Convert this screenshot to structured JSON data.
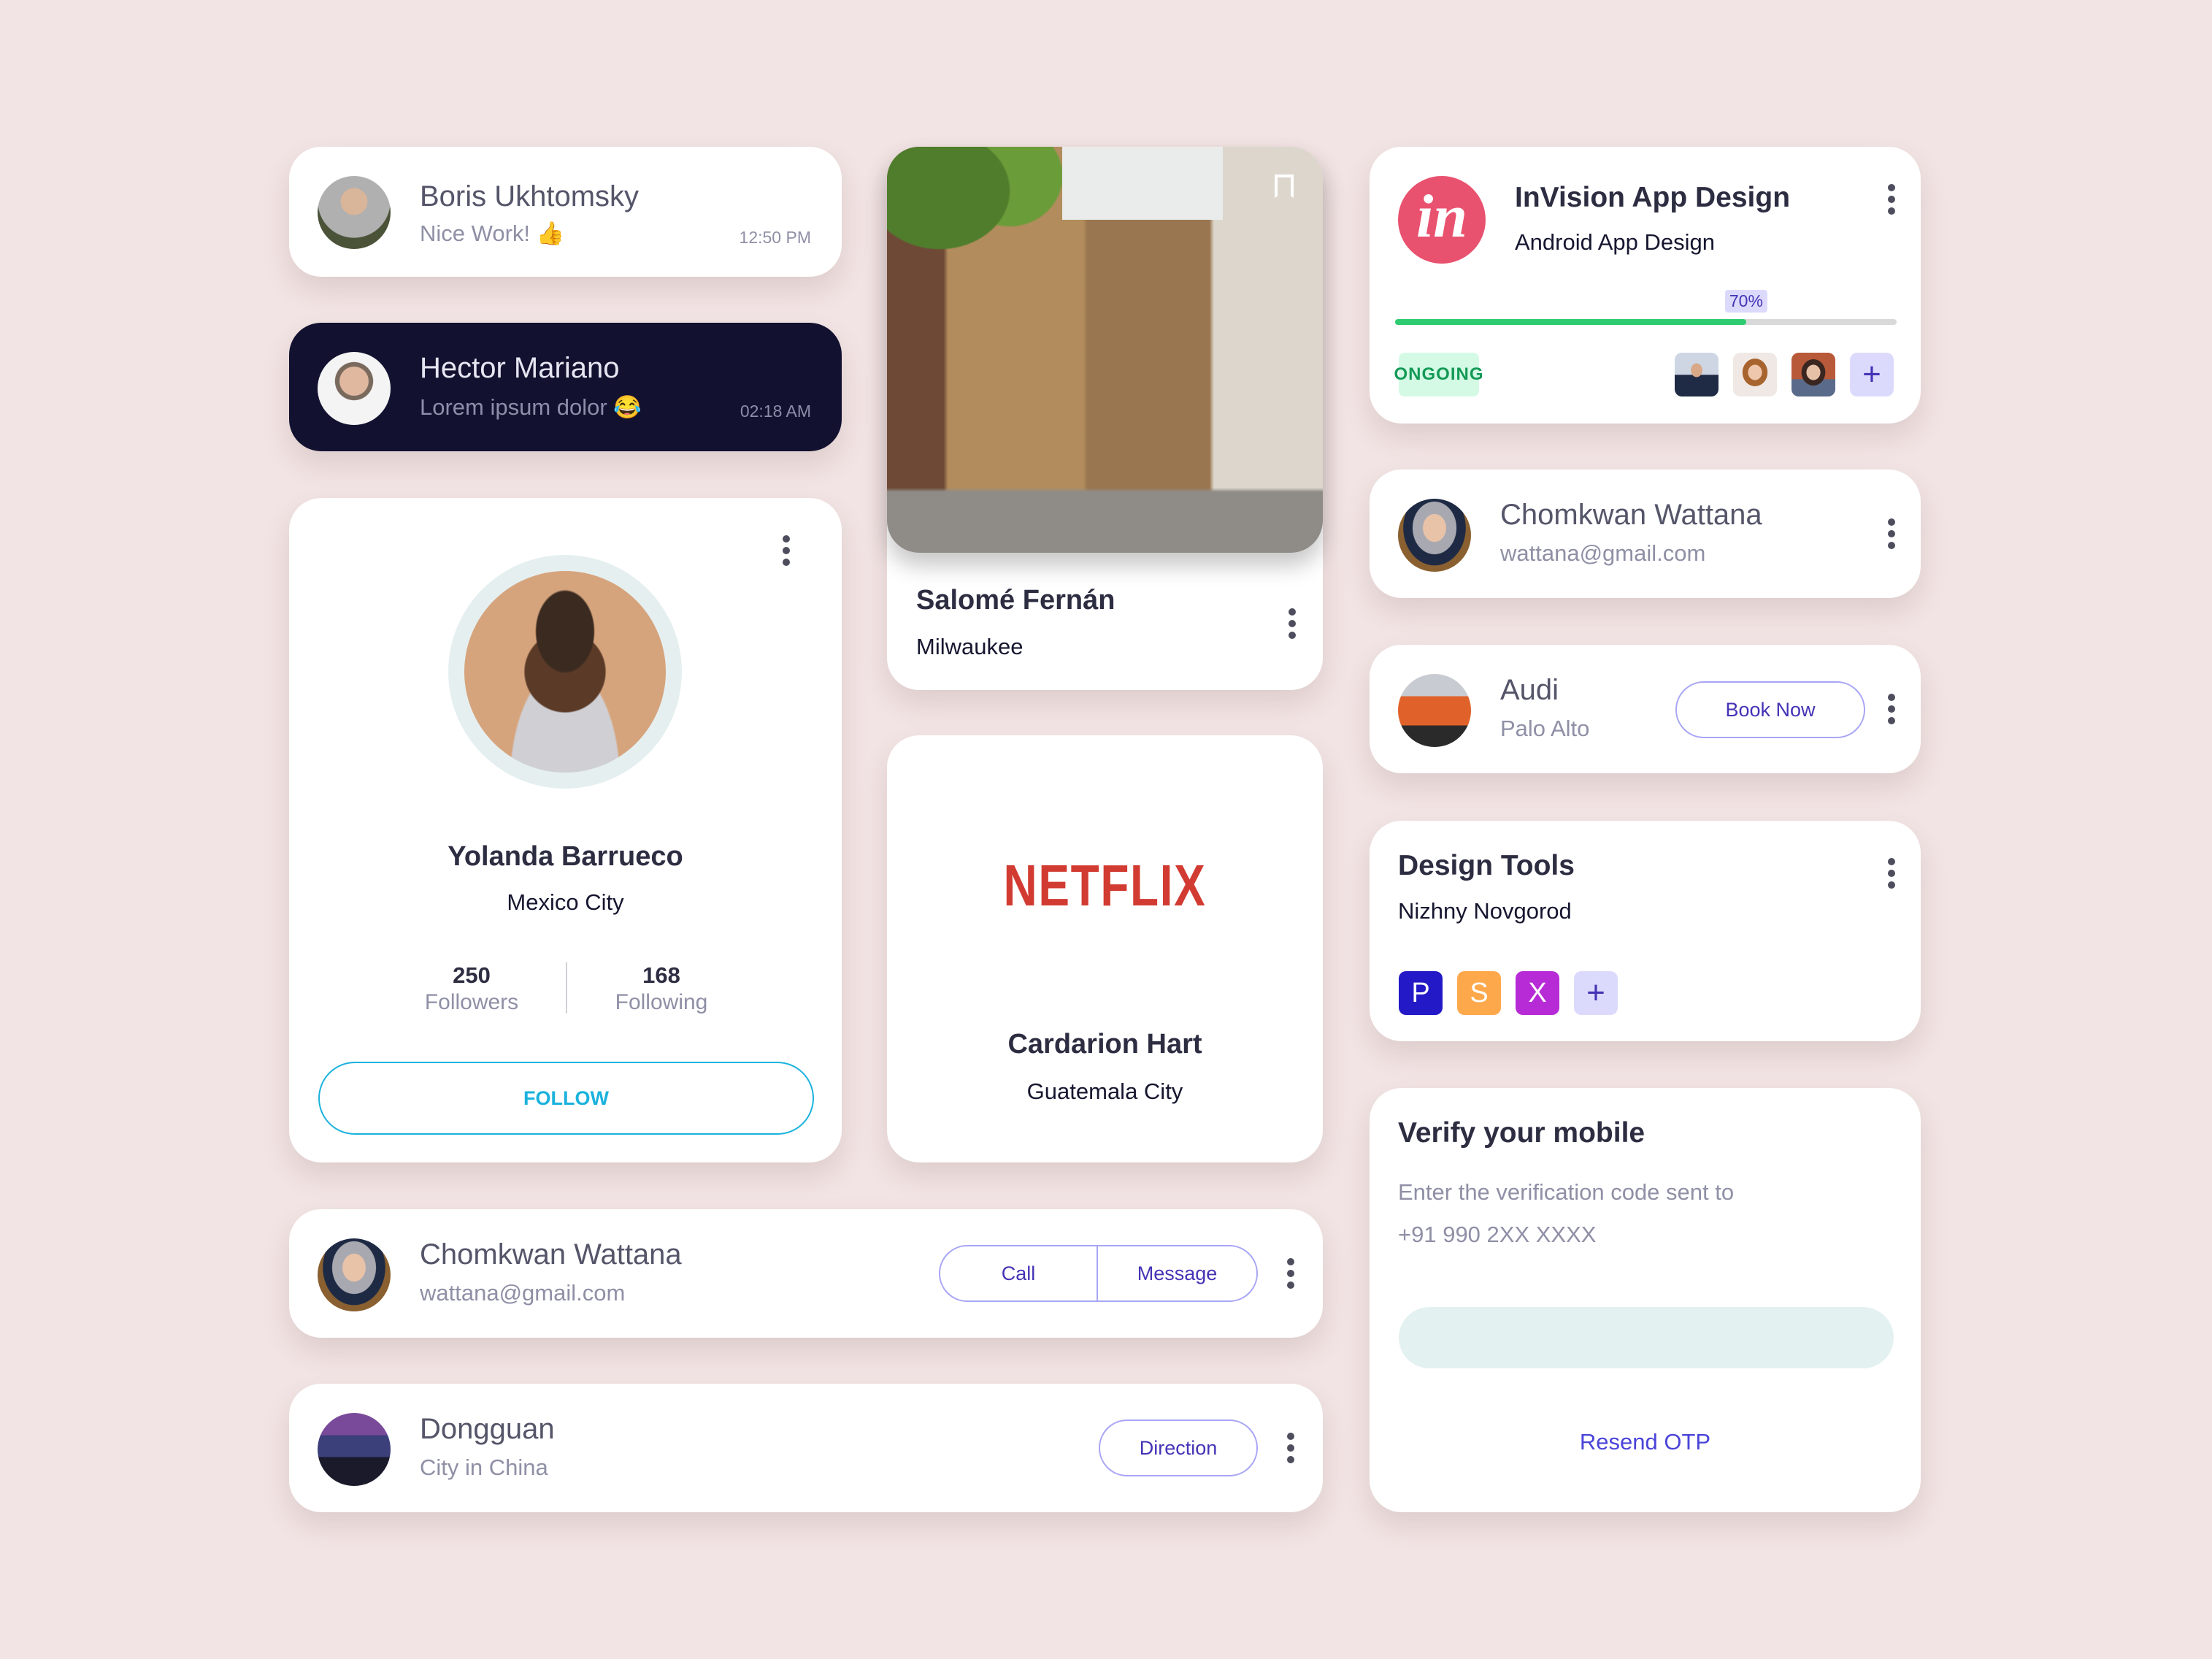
{
  "chats": [
    {
      "name": "Boris Ukhtomsky",
      "message": "Nice Work! 👍",
      "time": "12:50 PM",
      "theme": "light"
    },
    {
      "name": "Hector Mariano",
      "message": "Lorem ipsum dolor 😂",
      "time": "02:18 AM",
      "theme": "dark"
    }
  ],
  "profile": {
    "name": "Yolanda Barrueco",
    "location": "Mexico City",
    "followers_count": "250",
    "followers_label": "Followers",
    "following_count": "168",
    "following_label": "Following",
    "follow_button": "FOLLOW"
  },
  "photo_card": {
    "name": "Salomé Fernán",
    "location": "Milwaukee"
  },
  "netflix_card": {
    "logo_text": "NETFLIX",
    "name": "Cardarion Hart",
    "location": "Guatemala City"
  },
  "contact_bottom": {
    "name": "Chomkwan Wattana",
    "email": "wattana@gmail.com",
    "call_label": "Call",
    "message_label": "Message"
  },
  "place": {
    "name": "Dongguan",
    "subtitle": "City in China",
    "direction_label": "Direction"
  },
  "project": {
    "logo_text": "in",
    "title": "InVision App Design",
    "subtitle": "Android App Design",
    "progress_percent": 70,
    "progress_label": "70%",
    "status": "ONGOING",
    "add_member_label": "+"
  },
  "contact_right": {
    "name": "Chomkwan Wattana",
    "email": "wattana@gmail.com"
  },
  "booking": {
    "name": "Audi",
    "location": "Palo Alto",
    "button_label": "Book Now"
  },
  "design_tools": {
    "title": "Design Tools",
    "location": "Nizhny Novgorod",
    "tools": [
      {
        "letter": "P",
        "color": "#2419c6"
      },
      {
        "letter": "S",
        "color": "#fea84c"
      },
      {
        "letter": "X",
        "color": "#b72bd6"
      }
    ],
    "add_label": "+"
  },
  "verify": {
    "title": "Verify your mobile",
    "instruction": "Enter the verification code sent to",
    "phone": "+91 990 2XX XXXX",
    "code_value": "",
    "resend_label": "Resend OTP"
  },
  "colors": {
    "background": "#f2e4e4",
    "dark_card": "#121230",
    "accent_purple": "#4433b5",
    "follow_blue": "#1ab2dd",
    "progress_green": "#2ecc71",
    "invision_pink": "#e9526f",
    "netflix_red": "#d23b32"
  }
}
